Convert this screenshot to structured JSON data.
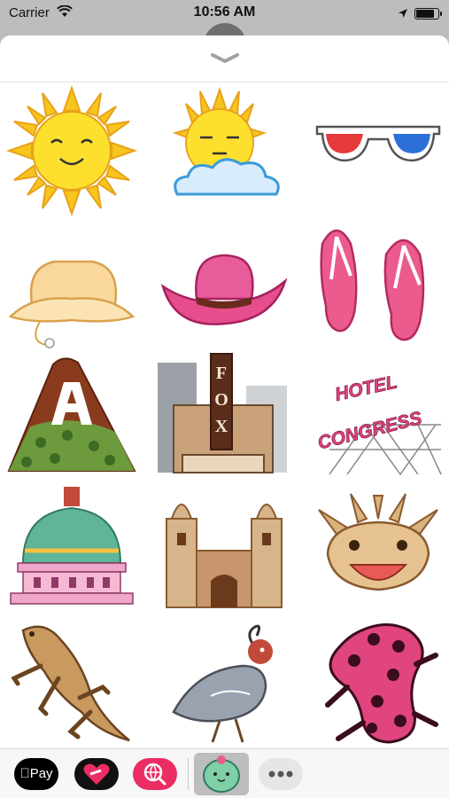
{
  "status_bar": {
    "carrier": "Carrier",
    "time": "10:56 AM",
    "battery_level": 0.85,
    "icons": [
      "wifi-icon",
      "location-arrow-icon",
      "battery-icon"
    ]
  },
  "sheet": {
    "grabber_icon": "chevron-down-icon"
  },
  "stickers": [
    {
      "name": "happy sun"
    },
    {
      "name": "sun behind cloud"
    },
    {
      "name": "3d glasses"
    },
    {
      "name": "bucket hat"
    },
    {
      "name": "pink cowboy hat"
    },
    {
      "name": "pink flip flops"
    },
    {
      "name": "a mountain"
    },
    {
      "name": "fox theatre"
    },
    {
      "name": "hotel congress sign",
      "text": "HOTEL CONGRESS"
    },
    {
      "name": "courthouse dome"
    },
    {
      "name": "mission church"
    },
    {
      "name": "horned lizard face"
    },
    {
      "name": "horned lizard"
    },
    {
      "name": "gambel's quail"
    },
    {
      "name": "gila monster"
    }
  ],
  "fox_sign": "FOX",
  "hotel_sign": [
    "HOTEL",
    "CONGRESS"
  ],
  "drawer": {
    "apple_pay_label": "Pay",
    "apps": [
      "apple-pay-app",
      "heart-app",
      "search-app",
      "cactus-sticker-app",
      "more-apps"
    ],
    "colors": {
      "search": "#ec2d63",
      "selected_bg": "#bdbdbd"
    }
  }
}
